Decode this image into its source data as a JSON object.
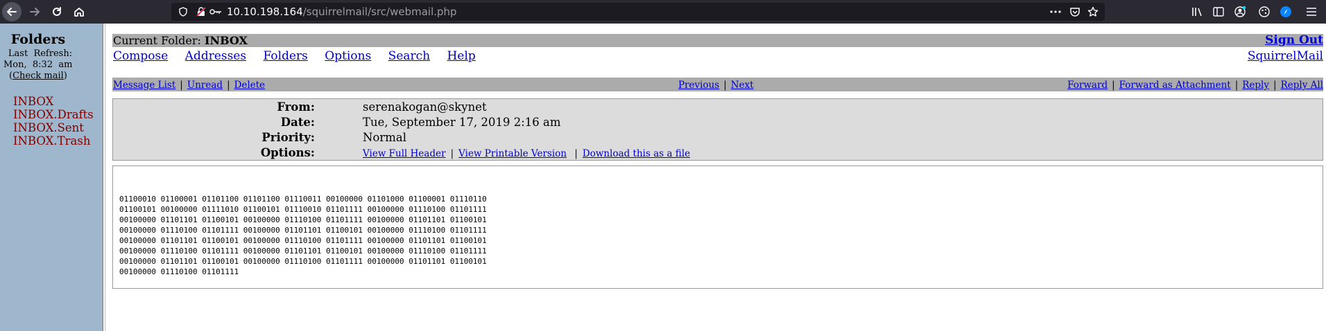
{
  "browser": {
    "url_host": "10.10.198.164",
    "url_path": "/squirrelmail/src/webmail.php"
  },
  "sidebar": {
    "title": "Folders",
    "last_refresh_label": "Last  Refresh:",
    "last_refresh_time": "Mon,  8:32  am",
    "check_mail_link": "Check mail",
    "folders": [
      "INBOX",
      "INBOX.Drafts",
      "INBOX.Sent",
      "INBOX.Trash"
    ]
  },
  "header": {
    "current_folder_label": "Current Folder:",
    "current_folder": "INBOX",
    "sign_out": "Sign Out",
    "menu": [
      "Compose",
      "Addresses",
      "Folders",
      "Options",
      "Search",
      "Help"
    ],
    "brand_link": "SquirrelMail"
  },
  "message_nav": {
    "left": [
      "Message List",
      "Unread",
      "Delete"
    ],
    "middle": [
      "Previous",
      "Next"
    ],
    "right": [
      "Forward",
      "Forward as Attachment",
      "Reply",
      "Reply All"
    ]
  },
  "message": {
    "from_label": "From:",
    "from": "serenakogan@skynet",
    "date_label": "Date:",
    "date": "Tue, September 17, 2019 2:16 am",
    "priority_label": "Priority:",
    "priority": "Normal",
    "options_label": "Options:",
    "options": [
      "View Full Header",
      "View Printable Version",
      "Download this as a file"
    ],
    "body": "01100010 01100001 01101100 01101100 01110011 00100000 01101000 01100001 01110110\n01100101 00100000 01111010 01100101 01110010 01101111 00100000 01110100 01101111\n00100000 01101101 01100101 00100000 01110100 01101111 00100000 01101101 01100101\n00100000 01110100 01101111 00100000 01101101 01100101 00100000 01110100 01101111\n00100000 01101101 01100101 00100000 01110100 01101111 00100000 01101101 01100101\n00100000 01110100 01101111 00100000 01101101 01100101 00100000 01110100 01101111\n00100000 01101101 01100101 00100000 01110100 01101111 00100000 01101101 01100101\n00100000 01110100 01101111"
  },
  "colors": {
    "toolbar_bg": "#2b2a33",
    "sidebar_bg": "#9fb7cc",
    "bar_gray": "#ababab",
    "header_box_bg": "#dcdcdc",
    "link": "#0000cc",
    "folder_link": "#800000"
  }
}
